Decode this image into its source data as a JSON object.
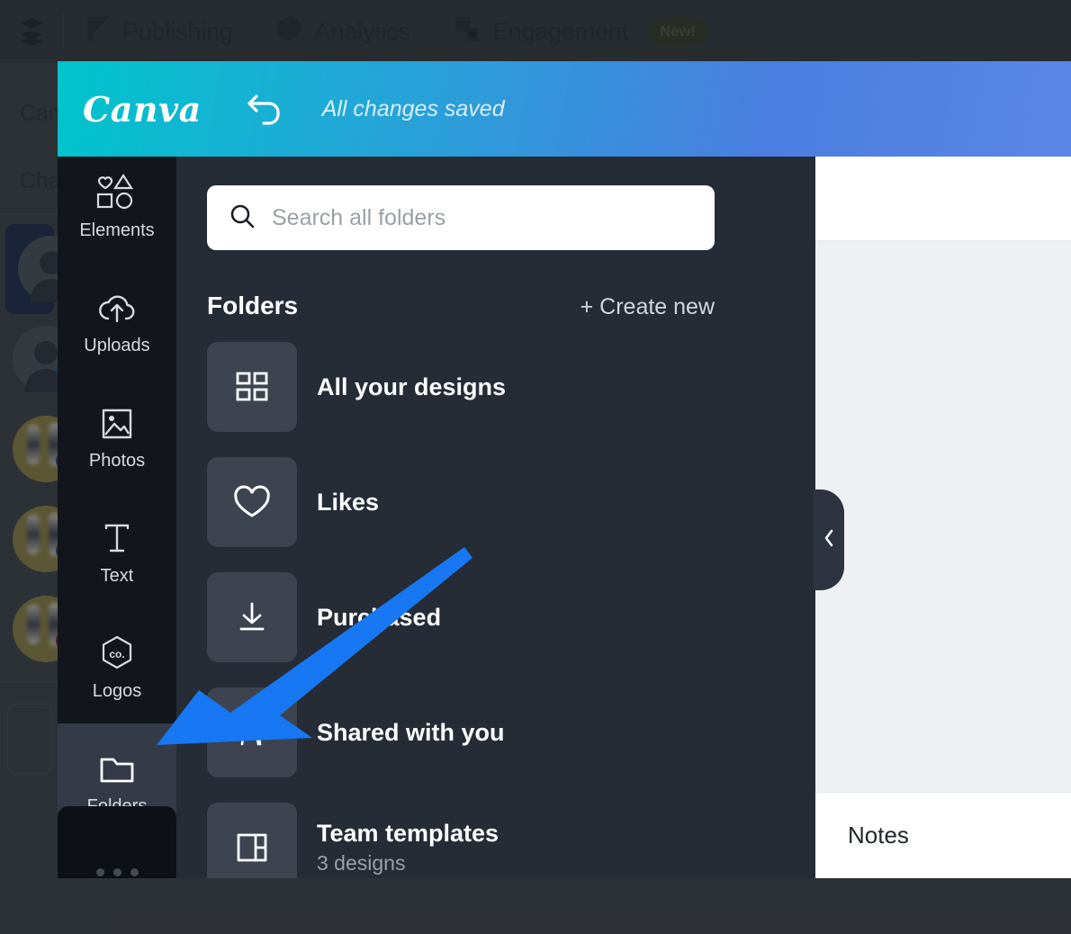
{
  "background_app": {
    "topnav": {
      "menu_icon": "layers-icon",
      "items": [
        {
          "label": "Publishing",
          "icon": "publishing-icon",
          "badge": ""
        },
        {
          "label": "Analytics",
          "icon": "pie-chart-icon",
          "badge": ""
        },
        {
          "label": "Engagement",
          "icon": "engagement-icon",
          "badge": "New!"
        }
      ]
    },
    "left_column": {
      "heading_1": "Campaigns",
      "heading_2": "Channels"
    }
  },
  "canva": {
    "header": {
      "logo": "Canva",
      "undo_icon": "undo-arrow-icon",
      "status": "All changes saved"
    },
    "rail": {
      "items": [
        {
          "label": "Elements",
          "icon": "shapes-icon",
          "active": false
        },
        {
          "label": "Uploads",
          "icon": "cloud-upload-icon",
          "active": false
        },
        {
          "label": "Photos",
          "icon": "image-icon",
          "active": false
        },
        {
          "label": "Text",
          "icon": "text-t-icon",
          "active": false
        },
        {
          "label": "Logos",
          "icon": "co-hexagon-icon",
          "active": false
        },
        {
          "label": "Folders",
          "icon": "folder-icon",
          "active": true
        }
      ],
      "more_icon": "more-dots-icon"
    },
    "search": {
      "icon": "search-icon",
      "placeholder": "Search all folders",
      "value": ""
    },
    "folders_section": {
      "title": "Folders",
      "create_new": "+ Create new",
      "items": [
        {
          "label": "All your designs",
          "sub": "",
          "icon": "grid-icon"
        },
        {
          "label": "Likes",
          "sub": "",
          "icon": "heart-icon"
        },
        {
          "label": "Purchased",
          "sub": "",
          "icon": "download-icon"
        },
        {
          "label": "Shared with you",
          "sub": "",
          "icon": "add-people-icon"
        },
        {
          "label": "Team templates",
          "sub": "3 designs",
          "icon": "layout-icon"
        }
      ]
    },
    "editor": {
      "notes_label": "Notes",
      "collapse_icon": "chevron-left-icon"
    }
  },
  "annotation": {
    "arrow_color": "#1877f2",
    "points_to": "Folders"
  }
}
